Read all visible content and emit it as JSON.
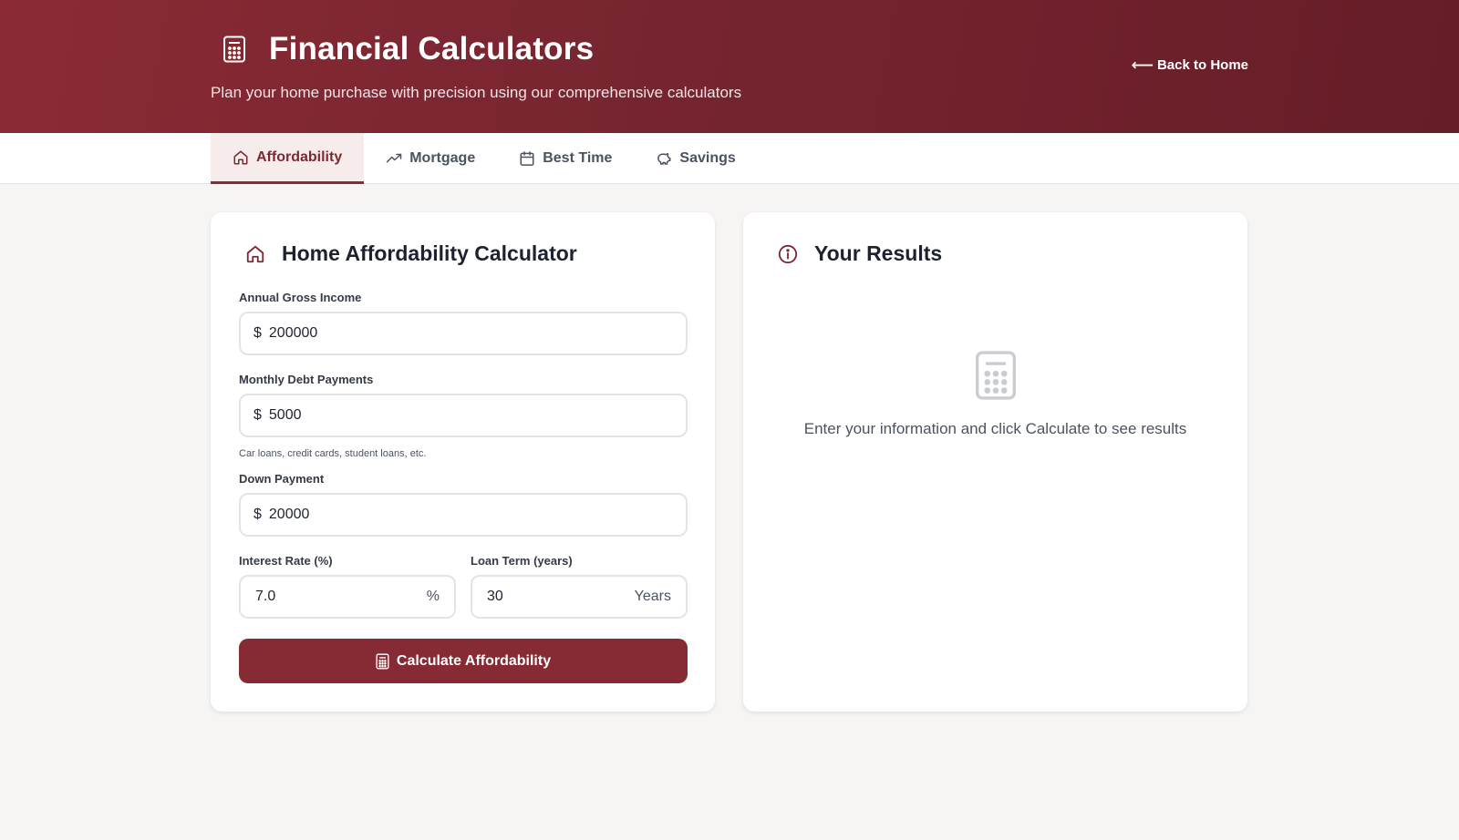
{
  "header": {
    "title": "Financial Calculators",
    "subtitle": "Plan your home purchase with precision using our comprehensive calculators",
    "back_label": "Back to Home",
    "back_arrow": "⟵"
  },
  "tabs": [
    {
      "label": "Affordability",
      "icon": "home-icon",
      "active": true
    },
    {
      "label": "Mortgage",
      "icon": "trending-up-icon",
      "active": false
    },
    {
      "label": "Best Time",
      "icon": "calendar-icon",
      "active": false
    },
    {
      "label": "Savings",
      "icon": "piggy-bank-icon",
      "active": false
    }
  ],
  "calculator": {
    "title": "Home Affordability Calculator",
    "fields": {
      "income": {
        "label": "Annual Gross Income",
        "prefix": "$",
        "value": "200000"
      },
      "debt": {
        "label": "Monthly Debt Payments",
        "prefix": "$",
        "value": "5000",
        "hint": "Car loans, credit cards, student loans, etc."
      },
      "down": {
        "label": "Down Payment",
        "prefix": "$",
        "value": "20000"
      },
      "rate": {
        "label": "Interest Rate (%)",
        "value": "7.0",
        "suffix": "%"
      },
      "term": {
        "label": "Loan Term (years)",
        "value": "30",
        "suffix": "Years"
      }
    },
    "button_label": "Calculate Affordability"
  },
  "results": {
    "title": "Your Results",
    "empty_message": "Enter your information and click Calculate to see results"
  },
  "colors": {
    "brand": "#862a33",
    "page_bg": "#f6f5f4"
  }
}
